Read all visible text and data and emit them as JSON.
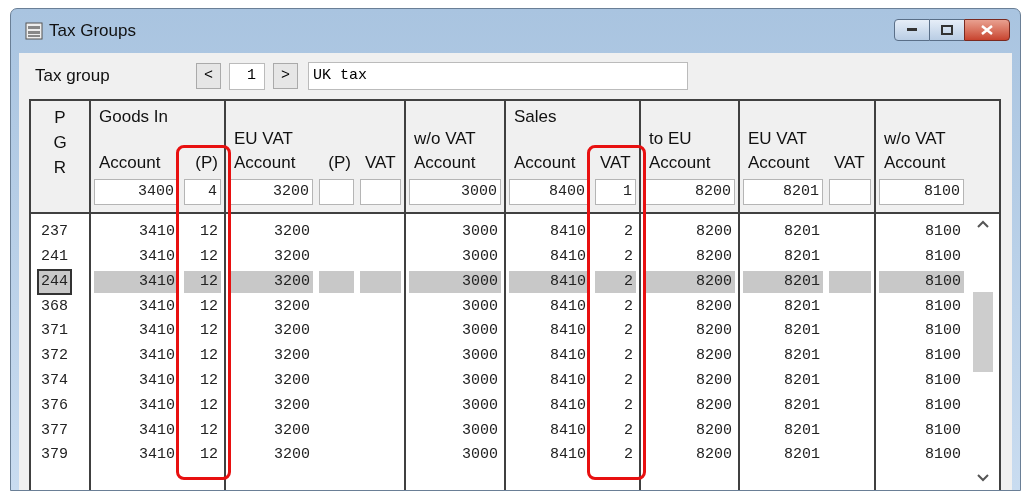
{
  "window": {
    "title": "Tax Groups"
  },
  "tax_group": {
    "label": "Tax group",
    "prev": "<",
    "number": "1",
    "next": ">",
    "name": "UK tax"
  },
  "columns": [
    {
      "label_lines": [
        "P",
        "G",
        "R"
      ],
      "highlighted": false
    },
    {
      "group": "Goods In",
      "label": "Account",
      "filter": "3400",
      "highlighted": false
    },
    {
      "label": "(P)",
      "filter": "4",
      "highlighted": true
    },
    {
      "subgroup": "EU VAT",
      "label": "Account",
      "filter": "3200",
      "highlighted": false
    },
    {
      "label": "(P)",
      "filter_field": true,
      "highlighted": false
    },
    {
      "label": "VAT",
      "filter_field": true,
      "highlighted": false
    },
    {
      "subgroup": "w/o VAT",
      "label": "Account",
      "filter": "3000",
      "highlighted": false
    },
    {
      "group": "Sales",
      "label": "Account",
      "filter": "8400",
      "highlighted": false
    },
    {
      "label": "VAT",
      "filter": "1",
      "highlighted": true
    },
    {
      "subgroup": "to EU",
      "label": "Account",
      "filter": "8200",
      "highlighted": false
    },
    {
      "subgroup": "EU VAT",
      "label": "Account",
      "filter": "8201",
      "highlighted": false
    },
    {
      "label": "VAT",
      "filter_field": true,
      "highlighted": false
    },
    {
      "subgroup": "w/o VAT",
      "label": "Account",
      "filter": "8100",
      "highlighted": false
    }
  ],
  "rows": [
    {
      "cells": [
        "237",
        "3410",
        "12",
        "3200",
        null,
        null,
        "3000",
        "8410",
        "2",
        "8200",
        "8201",
        null,
        "8100"
      ],
      "selected": false
    },
    {
      "cells": [
        "241",
        "3410",
        "12",
        "3200",
        null,
        null,
        "3000",
        "8410",
        "2",
        "8200",
        "8201",
        null,
        "8100"
      ],
      "selected": false
    },
    {
      "cells": [
        "244",
        "3410",
        "12",
        "3200",
        null,
        null,
        "3000",
        "8410",
        "2",
        "8200",
        "8201",
        null,
        "8100"
      ],
      "selected": true
    },
    {
      "cells": [
        "368",
        "3410",
        "12",
        "3200",
        null,
        null,
        "3000",
        "8410",
        "2",
        "8200",
        "8201",
        null,
        "8100"
      ],
      "selected": false
    },
    {
      "cells": [
        "371",
        "3410",
        "12",
        "3200",
        null,
        null,
        "3000",
        "8410",
        "2",
        "8200",
        "8201",
        null,
        "8100"
      ],
      "selected": false
    },
    {
      "cells": [
        "372",
        "3410",
        "12",
        "3200",
        null,
        null,
        "3000",
        "8410",
        "2",
        "8200",
        "8201",
        null,
        "8100"
      ],
      "selected": false
    },
    {
      "cells": [
        "374",
        "3410",
        "12",
        "3200",
        null,
        null,
        "3000",
        "8410",
        "2",
        "8200",
        "8201",
        null,
        "8100"
      ],
      "selected": false
    },
    {
      "cells": [
        "376",
        "3410",
        "12",
        "3200",
        null,
        null,
        "3000",
        "8410",
        "2",
        "8200",
        "8201",
        null,
        "8100"
      ],
      "selected": false
    },
    {
      "cells": [
        "377",
        "3410",
        "12",
        "3200",
        null,
        null,
        "3000",
        "8410",
        "2",
        "8200",
        "8201",
        null,
        "8100"
      ],
      "selected": false
    },
    {
      "cells": [
        "379",
        "3410",
        "12",
        "3200",
        null,
        null,
        "3000",
        "8410",
        "2",
        "8200",
        "8201",
        null,
        "8100"
      ],
      "selected": false
    }
  ]
}
